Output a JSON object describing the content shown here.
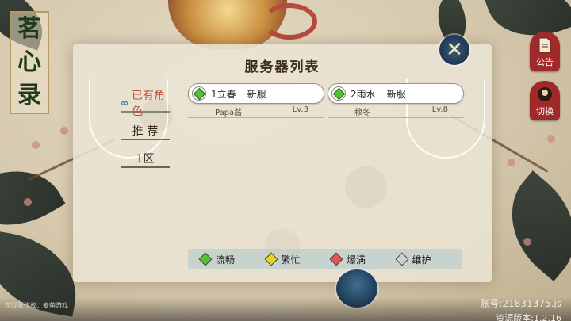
{
  "logo": {
    "chars": [
      "茗",
      "心",
      "录"
    ]
  },
  "side_buttons": {
    "notice_label": "公告",
    "switch_label": "切换"
  },
  "panel": {
    "title": "服务器列表",
    "close_icon": "close-icon"
  },
  "tabs": [
    {
      "label": "已有角色",
      "active": true,
      "icon": "infinity-icon"
    },
    {
      "label": "推 荐",
      "active": false
    },
    {
      "label": "1区",
      "active": false
    }
  ],
  "servers": [
    {
      "name": "1立春",
      "tag": "新服",
      "status": "smooth",
      "character": "Papa酱",
      "level": "Lv.3"
    },
    {
      "name": "2雨水",
      "tag": "新服",
      "status": "smooth",
      "character": "穆冬",
      "level": "Lv.8"
    }
  ],
  "legend": [
    {
      "label": "流畅",
      "color": "#54c034"
    },
    {
      "label": "繁忙",
      "color": "#e2d52a"
    },
    {
      "label": "爆满",
      "color": "#e2545b"
    },
    {
      "label": "维护",
      "color": "#cfd1cf"
    }
  ],
  "footer": {
    "left_text": "游戏著作权：麦萌游戏",
    "account": "账号:21831375.js",
    "version": "资源版本:1.2.16"
  }
}
